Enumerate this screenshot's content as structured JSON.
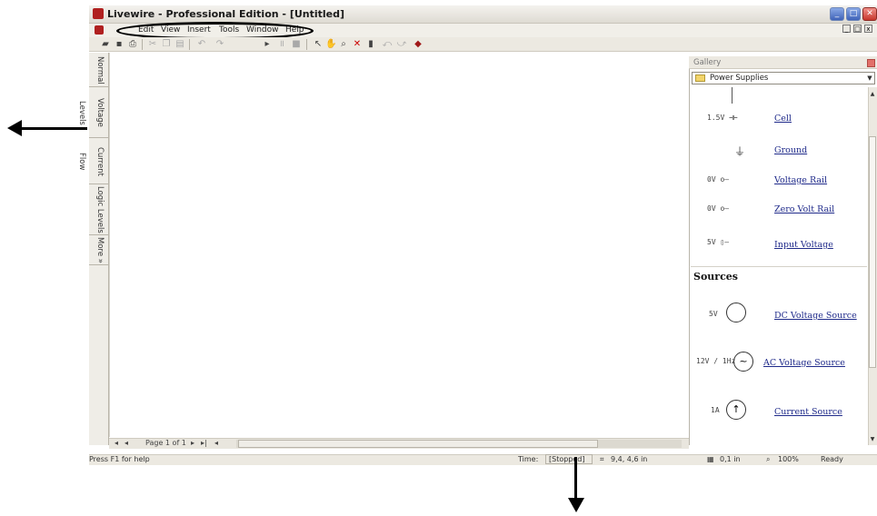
{
  "window": {
    "title": "Livewire - Professional Edition - [Untitled]",
    "controls": [
      "_",
      "□",
      "✕"
    ]
  },
  "menu": {
    "items": [
      "Edit",
      "View",
      "Insert",
      "Tools",
      "Window",
      "Help"
    ],
    "child_controls": [
      "_",
      "□",
      "x"
    ]
  },
  "left_tabs": [
    "Normal",
    "Voltage Levels",
    "Current Flow",
    "Logic Levels",
    "More »"
  ],
  "page_nav": {
    "label": "Page 1 of 1"
  },
  "status": {
    "help": "Press F1 for help",
    "time_label": "Time:",
    "time_value": "[Stopped]",
    "coords": "9,4, 4,6 in",
    "grid": "0,1 in",
    "zoom": "100%",
    "state": "Ready"
  },
  "gallery": {
    "title": "Gallery",
    "category": "Power Supplies",
    "items": [
      {
        "symbol": "1.5V ⊣⊢",
        "label": "Cell"
      },
      {
        "symbol": "⏚",
        "label": "Ground"
      },
      {
        "symbol": "0V o—",
        "label": "Voltage Rail"
      },
      {
        "symbol": "0V o—",
        "label": "Zero Volt Rail"
      },
      {
        "symbol": "5V ▯—",
        "label": "Input Voltage"
      }
    ],
    "section": "Sources",
    "sources": [
      {
        "symbol": "5V",
        "label": "DC Voltage Source"
      },
      {
        "symbol": "12V / 1Hz",
        "label": "AC Voltage Source"
      },
      {
        "symbol": "1A",
        "label": "Current Source"
      }
    ]
  },
  "colors": {
    "link": "#1f2a8a",
    "app_accent": "#b02020",
    "window_chrome": "#ece9e1"
  }
}
